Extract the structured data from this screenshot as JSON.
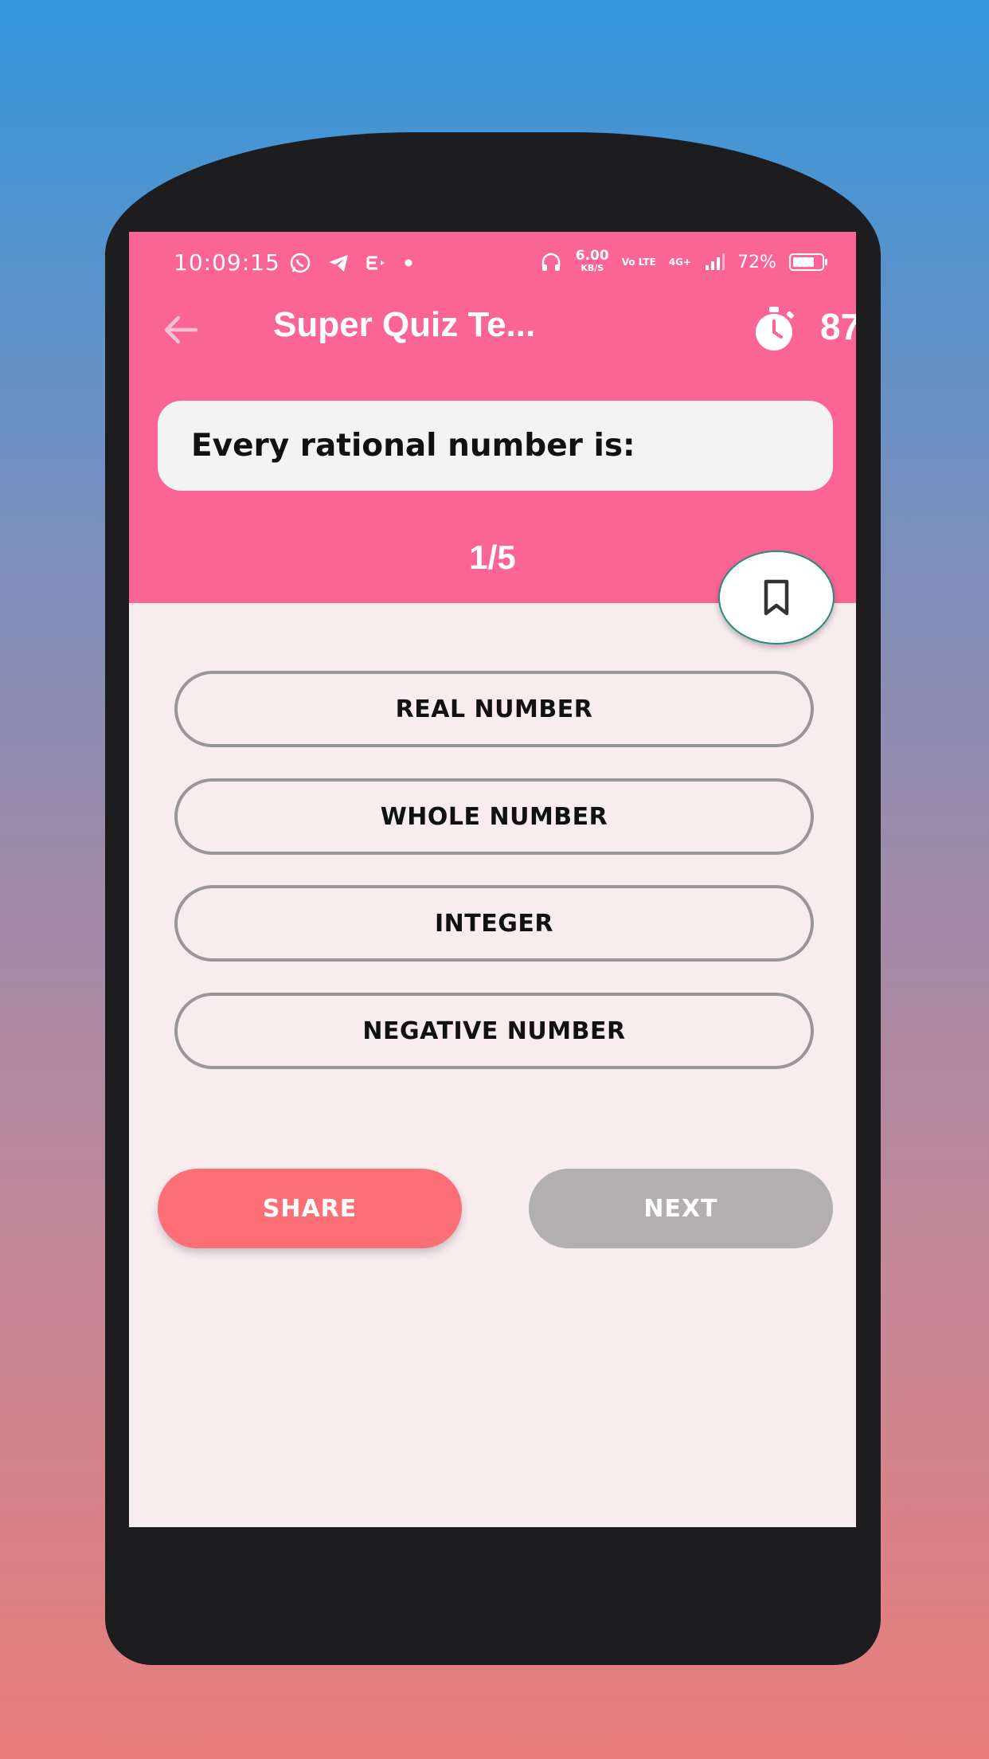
{
  "status_bar": {
    "time": "10:09:15",
    "left_icons": [
      "whatsapp-icon",
      "telegram-icon",
      "notification-icon",
      "dot-icon"
    ],
    "network_speed": "6.00",
    "network_speed_unit": "KB/S",
    "volte": "Vo LTE",
    "signal": "4G+",
    "battery_percent": "72%"
  },
  "toolbar": {
    "title": "Super Quiz Te...",
    "timer_value": "87"
  },
  "question": {
    "text": "Every rational number is:",
    "progress": "1/5"
  },
  "options": [
    {
      "label": "REAL NUMBER"
    },
    {
      "label": "WHOLE NUMBER"
    },
    {
      "label": "INTEGER"
    },
    {
      "label": "NEGATIVE NUMBER"
    }
  ],
  "actions": {
    "share_label": "SHARE",
    "next_label": "NEXT"
  },
  "colors": {
    "header": "#fb6595",
    "screen_bg": "#f8ecef",
    "share": "#fd6f77",
    "next": "#b3aeb0",
    "option_border": "#9a9597"
  }
}
